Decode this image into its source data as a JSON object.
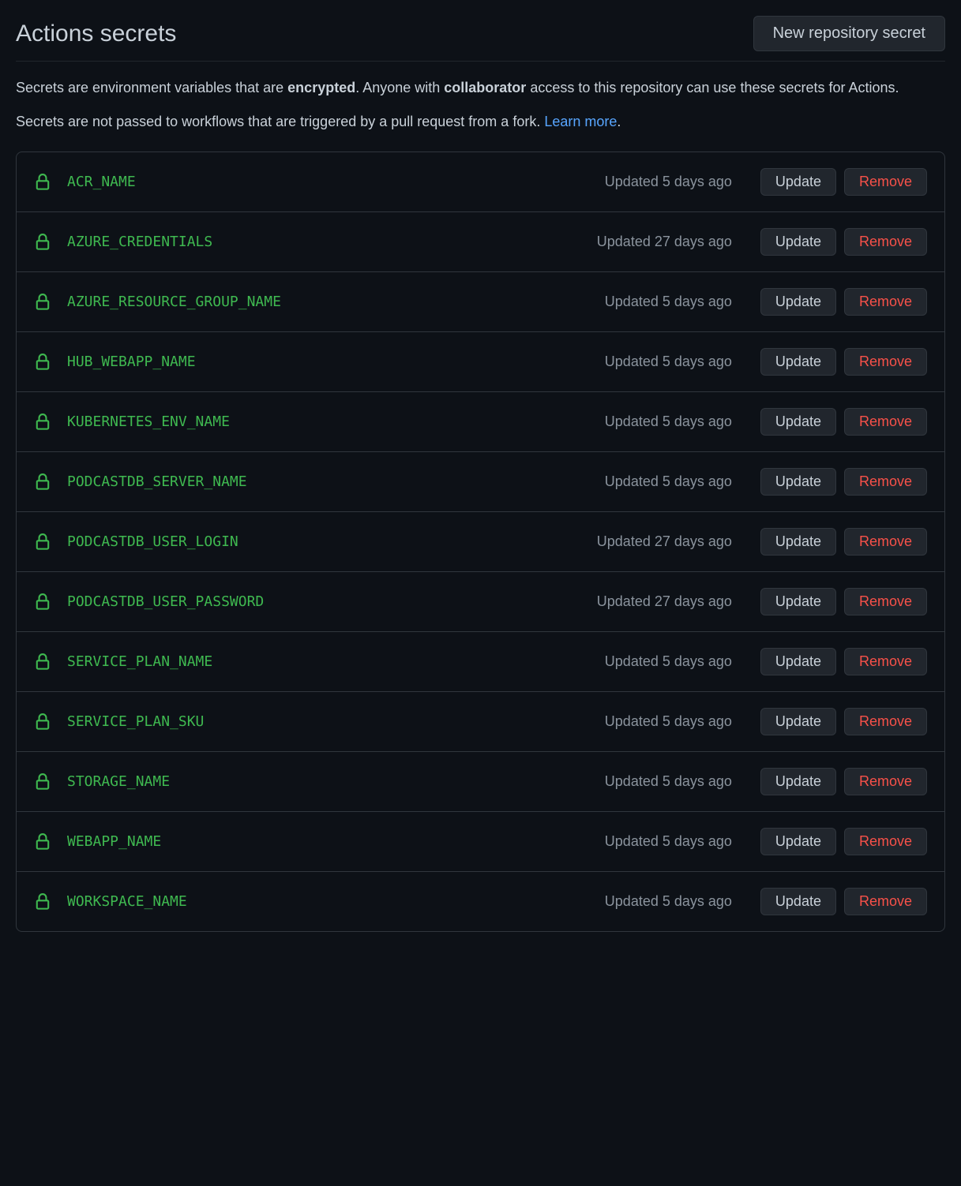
{
  "header": {
    "title": "Actions secrets",
    "new_button": "New repository secret"
  },
  "description": {
    "line1_pre": "Secrets are environment variables that are ",
    "line1_strong1": "encrypted",
    "line1_mid": ". Anyone with ",
    "line1_strong2": "collaborator",
    "line1_end": " access to this repository can use these secrets for Actions.",
    "line2_pre": "Secrets are not passed to workflows that are triggered by a pull request from a fork. ",
    "line2_link": "Learn more",
    "line2_end": "."
  },
  "buttons": {
    "update": "Update",
    "remove": "Remove"
  },
  "secrets": [
    {
      "name": "ACR_NAME",
      "updated": "Updated 5 days ago"
    },
    {
      "name": "AZURE_CREDENTIALS",
      "updated": "Updated 27 days ago"
    },
    {
      "name": "AZURE_RESOURCE_GROUP_NAME",
      "updated": "Updated 5 days ago"
    },
    {
      "name": "HUB_WEBAPP_NAME",
      "updated": "Updated 5 days ago"
    },
    {
      "name": "KUBERNETES_ENV_NAME",
      "updated": "Updated 5 days ago"
    },
    {
      "name": "PODCASTDB_SERVER_NAME",
      "updated": "Updated 5 days ago"
    },
    {
      "name": "PODCASTDB_USER_LOGIN",
      "updated": "Updated 27 days ago"
    },
    {
      "name": "PODCASTDB_USER_PASSWORD",
      "updated": "Updated 27 days ago"
    },
    {
      "name": "SERVICE_PLAN_NAME",
      "updated": "Updated 5 days ago"
    },
    {
      "name": "SERVICE_PLAN_SKU",
      "updated": "Updated 5 days ago"
    },
    {
      "name": "STORAGE_NAME",
      "updated": "Updated 5 days ago"
    },
    {
      "name": "WEBAPP_NAME",
      "updated": "Updated 5 days ago"
    },
    {
      "name": "WORKSPACE_NAME",
      "updated": "Updated 5 days ago"
    }
  ]
}
